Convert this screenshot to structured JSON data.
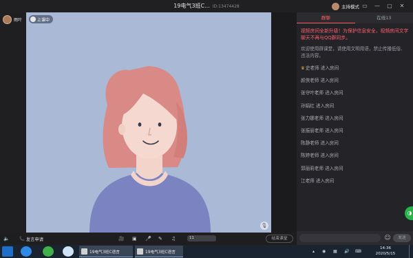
{
  "titlebar": {
    "title": "19电气3班C...",
    "room_id": "ID:13474428",
    "host_mode_label": "主持模式",
    "window_buttons": [
      "▭",
      "—",
      "▢",
      "✕"
    ]
  },
  "teacher": {
    "name": "雨叶"
  },
  "video": {
    "status_label": "上课中"
  },
  "right_panel": {
    "tabs": [
      {
        "label": "群聊",
        "active": true
      },
      {
        "label": "在线13",
        "active": false
      }
    ],
    "notice": "视频房间全新升级！为保护信息安全，视频房间文字聊天不再与QQ群同步。",
    "welcome": "欢迎使用群课堂，请使用文明用语，禁止传播低俗、违法内容。",
    "entries": [
      "史老师 进入房间",
      "颜侠老师 进入房间",
      "张守叶老师 进入房间",
      "孙娟红 进入房间",
      "张力娜老师 进入房间",
      "张振丽老师 进入房间",
      "陈静老师 进入房间",
      "陈婷老师 进入房间",
      "郭丽莉老师 进入房间",
      "江老师 进入房间"
    ],
    "input_placeholder": "",
    "send_label": "发送"
  },
  "toolbar": {
    "speak_label": "发言申请",
    "volume_label": "11",
    "end_label": "结束课堂"
  },
  "taskbar": {
    "tasks": [
      "19电气3班C语言",
      "19电气3班C语言"
    ],
    "time": "14:36",
    "date": "2020/5/15"
  },
  "colors": {
    "accent_red": "#ff5c5c",
    "video_bg": "#a9b9d6",
    "share_green": "#26b34a"
  }
}
